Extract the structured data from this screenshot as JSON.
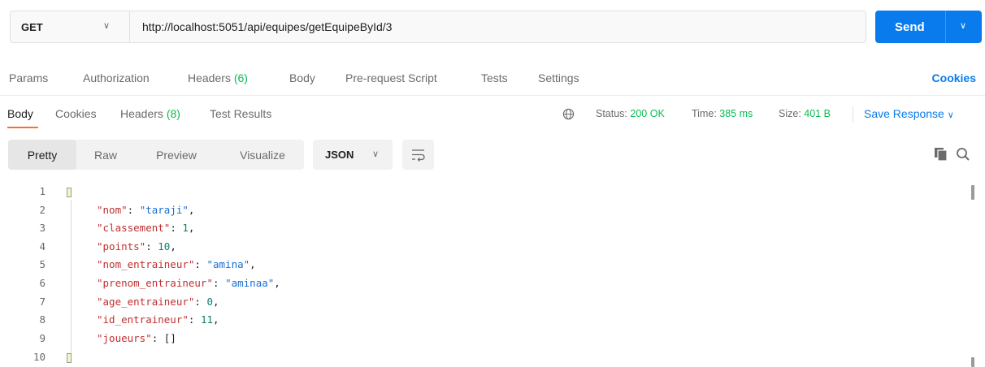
{
  "request": {
    "method": "GET",
    "url": "http://localhost:5051/api/equipes/getEquipeById/3",
    "send_label": "Send"
  },
  "request_tabs": {
    "params": "Params",
    "authorization": "Authorization",
    "headers": "Headers",
    "headers_count": "(6)",
    "body": "Body",
    "pre_request": "Pre-request Script",
    "tests": "Tests",
    "settings": "Settings",
    "cookies": "Cookies"
  },
  "response_tabs": {
    "body": "Body",
    "cookies": "Cookies",
    "headers": "Headers",
    "headers_count": "(8)",
    "test_results": "Test Results"
  },
  "status": {
    "status_label": "Status:",
    "status_value": "200 OK",
    "time_label": "Time:",
    "time_value": "385 ms",
    "size_label": "Size:",
    "size_value": "401 B",
    "save_response": "Save Response"
  },
  "format": {
    "pretty": "Pretty",
    "raw": "Raw",
    "preview": "Preview",
    "visualize": "Visualize",
    "language": "JSON"
  },
  "code": {
    "line_numbers": [
      "1",
      "2",
      "3",
      "4",
      "5",
      "6",
      "7",
      "8",
      "9",
      "10"
    ],
    "lines": [
      {
        "key": "\"nom\"",
        "value": "\"taraji\"",
        "type": "string"
      },
      {
        "key": "\"classement\"",
        "value": "1",
        "type": "number"
      },
      {
        "key": "\"points\"",
        "value": "10",
        "type": "number"
      },
      {
        "key": "\"nom_entraineur\"",
        "value": "\"amina\"",
        "type": "string"
      },
      {
        "key": "\"prenom_entraineur\"",
        "value": "\"aminaa\"",
        "type": "string"
      },
      {
        "key": "\"age_entraineur\"",
        "value": "0",
        "type": "number"
      },
      {
        "key": "\"id_entraineur\"",
        "value": "11",
        "type": "number"
      },
      {
        "key": "\"joueurs\"",
        "value": "[]",
        "type": "array"
      }
    ]
  },
  "colors": {
    "accent": "#097bed",
    "success": "#0cbb52",
    "active_tab": "#ff6c37"
  }
}
